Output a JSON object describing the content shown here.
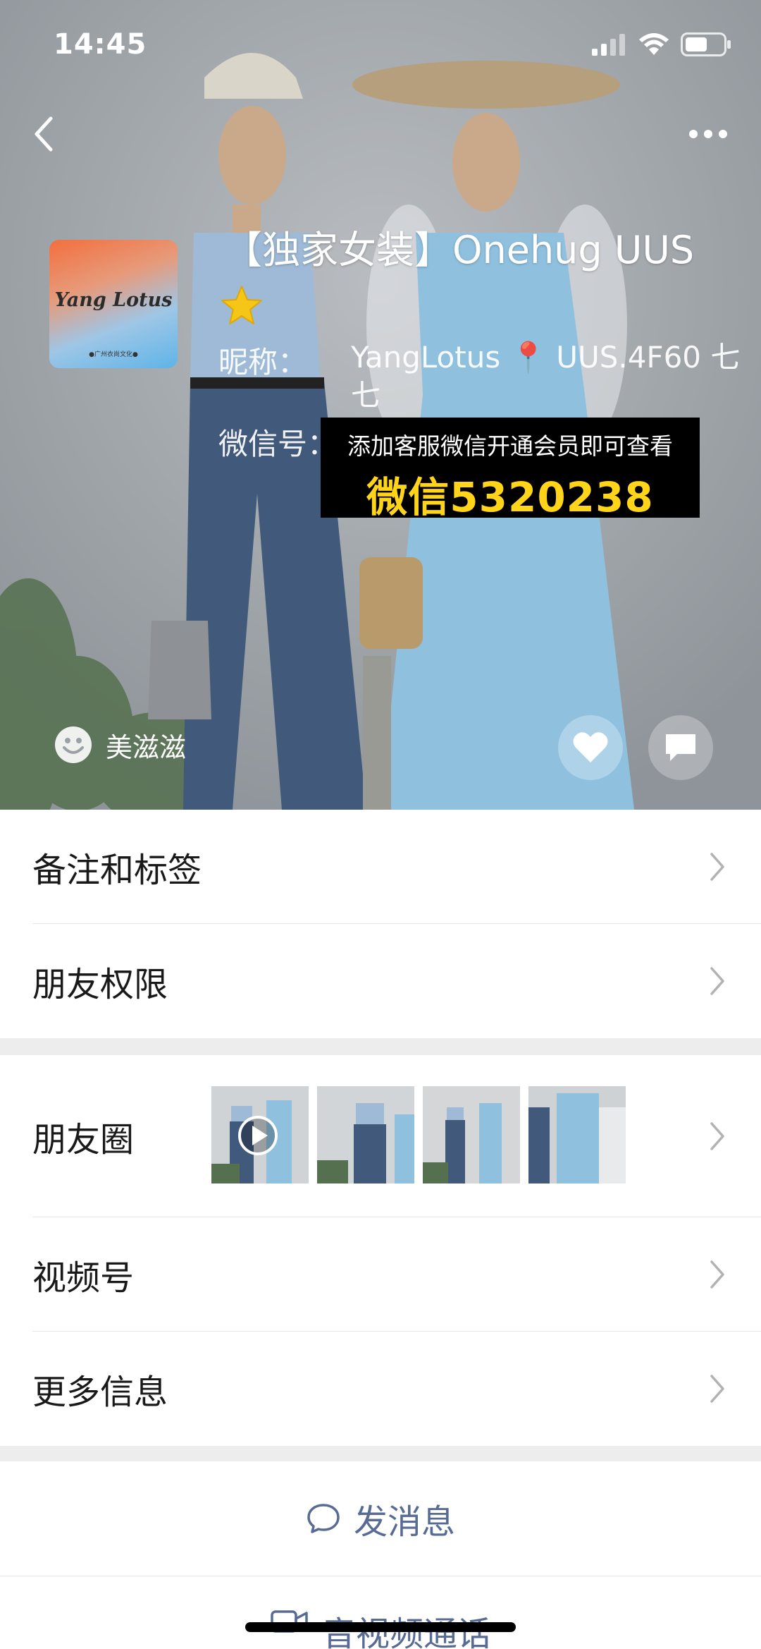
{
  "status": {
    "time": "14:45"
  },
  "profile": {
    "avatar_brand": "Yang Lotus",
    "avatar_small_text": "●广州衣尚文化●",
    "name": "【独家女装】Onehug  UUS",
    "nickname_label": "昵称：",
    "nickname_value": "YangLotus 📍 UUS.4F60 七七",
    "wechat_id_label": "微信号：",
    "mood": "美滋滋"
  },
  "overlay": {
    "line1": "添加客服微信开通会员即可查看",
    "line2": "微信5320238",
    "highlight_color": "#ffd419"
  },
  "menu": {
    "notes_tags": "备注和标签",
    "friend_permissions": "朋友权限",
    "moments": "朋友圈",
    "channels": "视频号",
    "more_info": "更多信息"
  },
  "actions": {
    "send_message": "发消息",
    "video_call": "音视频通话",
    "link_color": "#576b95"
  },
  "icons": {
    "back": "chevron-left-icon",
    "more": "more-dots-icon",
    "like": "heart-icon",
    "comment": "comment-icon",
    "play": "play-icon"
  }
}
